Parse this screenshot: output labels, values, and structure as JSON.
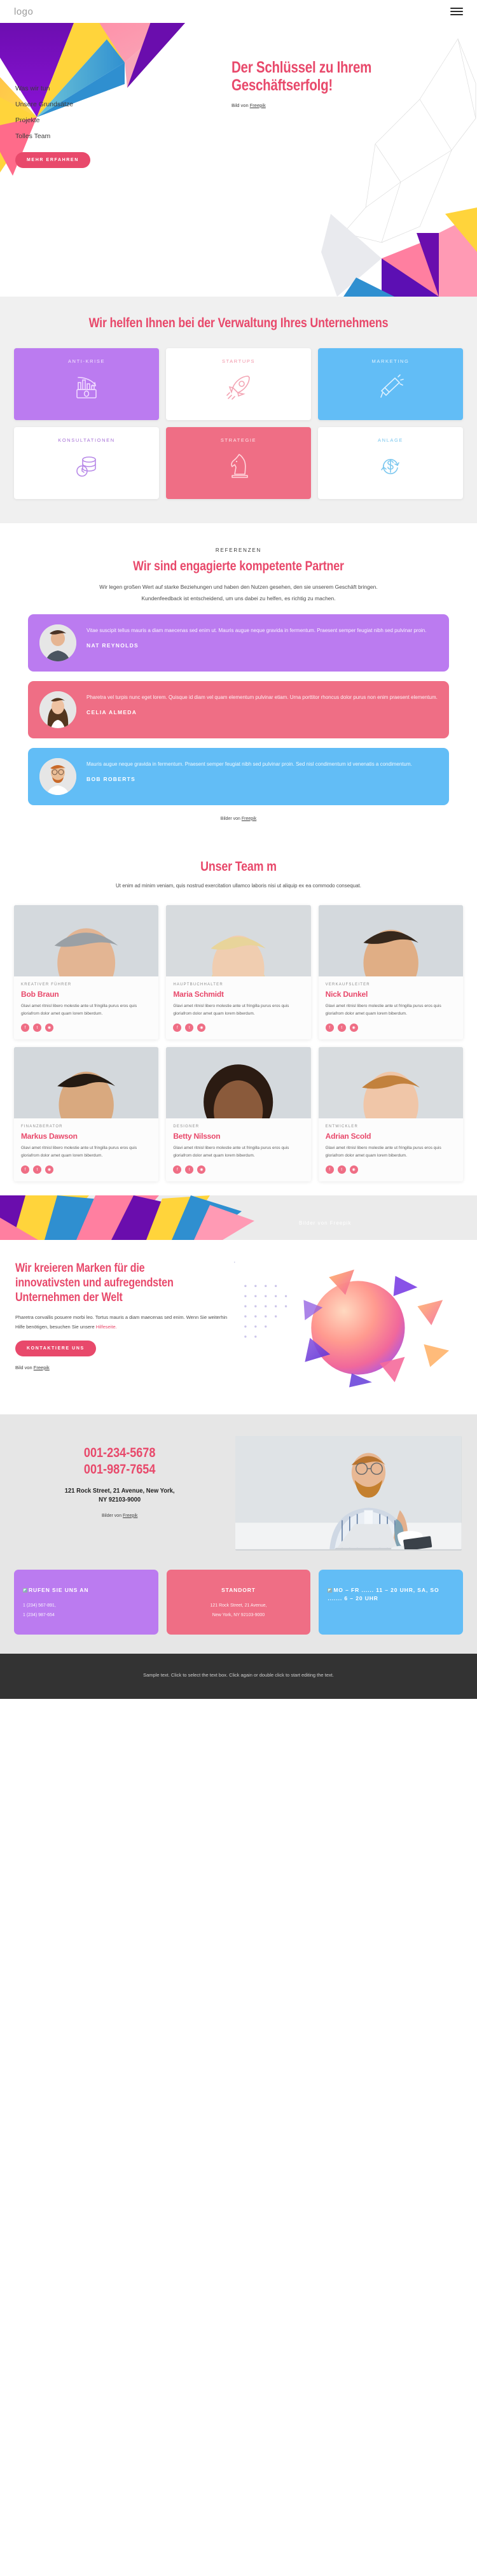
{
  "header": {
    "logo": "logo",
    "menu_icon": "hamburger-menu-icon"
  },
  "hero": {
    "nav": [
      {
        "label": "Was wir tun"
      },
      {
        "label": "Unsere Grundsätze"
      },
      {
        "label": "Projekte"
      },
      {
        "label": "Tolles Team"
      }
    ],
    "cta": "MEHR ERFAHREN",
    "title": "Der Schlüssel zu Ihrem Geschäftserfolg!",
    "credit_prefix": "Bild von ",
    "credit_link": "Freepik"
  },
  "services": {
    "title": "Wir helfen Ihnen bei der Verwaltung Ihres Unternehmens",
    "cards": [
      {
        "label": "ANTI-KRISE",
        "icon": "money-decline-icon",
        "style": "c-purple"
      },
      {
        "label": "STARTUPS",
        "icon": "rocket-icon",
        "style": "c-white",
        "label_class": "lbl-pink"
      },
      {
        "label": "MARKETING",
        "icon": "megaphone-icon",
        "style": "c-blue"
      },
      {
        "label": "KONSULTATIONEN",
        "icon": "coins-clock-icon",
        "style": "c-white",
        "label_class": "lbl-purple"
      },
      {
        "label": "STRATEGIE",
        "icon": "chess-knight-icon",
        "style": "c-pink"
      },
      {
        "label": "ANLAGE",
        "icon": "dollar-refresh-icon",
        "style": "c-white",
        "label_class": "lbl-blue"
      }
    ]
  },
  "testimonials": {
    "eyebrow": "REFERENZEN",
    "title": "Wir sind engagierte kompetente Partner",
    "subtitle": "Wir legen großen Wert auf starke Beziehungen und haben den Nutzen gesehen, den sie unserem Geschäft bringen. Kundenfeedback ist entscheidend, um uns dabei zu helfen, es richtig zu machen.",
    "items": [
      {
        "text": "Vitae suscipit tellus mauris a diam maecenas sed enim ut. Mauris augue neque gravida in fermentum. Praesent semper feugiat nibh sed pulvinar proin.",
        "name": "NAT REYNOLDS",
        "style": "t-purple"
      },
      {
        "text": "Pharetra vel turpis nunc eget lorem. Quisque id diam vel quam elementum pulvinar etiam. Urna porttitor rhoncus dolor purus non enim praesent elementum.",
        "name": "CELIA ALMEDA",
        "style": "t-pink"
      },
      {
        "text": "Mauris augue neque gravida in fermentum. Praesent semper feugiat nibh sed pulvinar proin. Sed nisl condimentum id venenatis a condimentum.",
        "name": "BOB ROBERTS",
        "style": "t-blue"
      }
    ],
    "credit_prefix": "Bilder von ",
    "credit_link": "Freepik"
  },
  "team": {
    "title": "Unser Team m",
    "subtitle": "Ut enim ad minim veniam, quis nostrud exercitation ullamco laboris nisi ut aliquip ex ea commodo consequat.",
    "members": [
      {
        "role": "KREATIVER FÜHRER",
        "name": "Bob Braun",
        "desc": "Glavi amet ritnisl libero molestie ante ut fringilla purus eros quis gloriafrom dolor amet quam lorem biberdum."
      },
      {
        "role": "HAUPTBUCHHALTER",
        "name": "Maria Schmidt",
        "desc": "Glavi amet ritnisl libero molestie ante ut fringilla purus eros quis gloriafrom dolor amet quam lorem biberdum."
      },
      {
        "role": "VERKAUFSLEITER",
        "name": "Nick Dunkel",
        "desc": "Glavi amet ritnisl libero molestie ante ut fringilla purus eros quis gloriafrom dolor amet quam lorem biberdum."
      },
      {
        "role": "FINANZBERATOR",
        "name": "Markus Dawson",
        "desc": "Glavi amet ritnisl libero molestie ante ut fringilla purus eros quis gloriafrom dolor amet quam lorem biberdum."
      },
      {
        "role": "DESIGNER",
        "name": "Betty Nilsson",
        "desc": "Glavi amet ritnisl libero molestie ante ut fringilla purus eros quis gloriafrom dolor amet quam lorem biberdum."
      },
      {
        "role": "ENTWICKLER",
        "name": "Adrian Scold",
        "desc": "Glavi amet ritnisl libero molestie ante ut fringilla purus eros quis gloriafrom dolor amet quam lorem biberdum."
      }
    ],
    "social_icons": [
      "facebook-icon",
      "twitter-icon",
      "instagram-icon"
    ],
    "credit_prefix": "Bilder von ",
    "credit_link": "Freepik"
  },
  "brand": {
    "title": "Wir kreieren Marken für die innovativsten und aufregendsten Unternehmen der Welt",
    "text": "Pharetra convallis posuere morbi leo. Tortus mauris a diam maecenas sed enim. Wenn Sie weiterhin Hilfe benötigen, besuchen Sie unsere",
    "link": "Hilfeseite.",
    "cta": "KONTAKTIERE UNS",
    "credit_prefix": "Bild von ",
    "credit_link": "Freepik"
  },
  "contact": {
    "phone1": "001-234-5678",
    "phone2": "001-987-7654",
    "address_line1": "121 Rock Street, 21 Avenue, New York,",
    "address_line2": "NY 92103-9000",
    "credit_prefix": "Bilder von ",
    "credit_link": "Freepik",
    "cards": [
      {
        "title": "RUFEN SIE UNS AN",
        "broken_image": true,
        "lines": [
          "1 (234) 567-891,",
          "1 (234) 987-654"
        ],
        "style": "i-purple",
        "align": ""
      },
      {
        "title": "STANDORT",
        "broken_image": false,
        "lines": [
          "121 Rock Street, 21 Avenue,",
          "New York, NY 92103-9000"
        ],
        "style": "i-pink",
        "align": "icard-center"
      },
      {
        "title": "MO – FR ...... 11 – 20 UHR, SA, SO ....... 6 – 20 UHR",
        "broken_image": true,
        "lines": [],
        "style": "i-blue",
        "align": ""
      }
    ]
  },
  "footer": {
    "text": "Sample text. Click to select the text box. Click again or double click to start editing the text."
  },
  "colors": {
    "accent_pink": "#e8496b",
    "purple": "#bb7bf0",
    "blue": "#62bdf6",
    "rose": "#ef6e85"
  }
}
